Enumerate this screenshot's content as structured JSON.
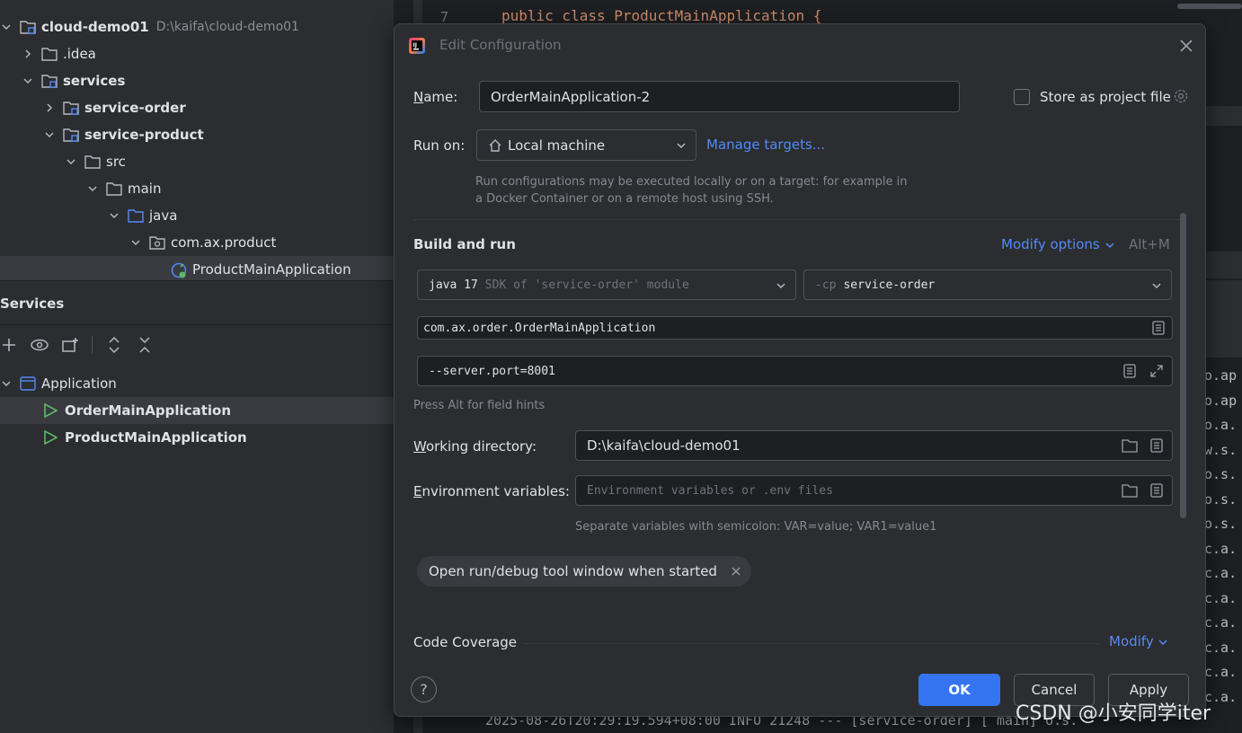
{
  "project_tree": {
    "root": {
      "name": "cloud-demo01",
      "path": "D:\\kaifa\\cloud-demo01"
    },
    "items": [
      {
        "label": ".idea"
      },
      {
        "label": "services"
      },
      {
        "label": "service-order"
      },
      {
        "label": "service-product"
      },
      {
        "label": "src"
      },
      {
        "label": "main"
      },
      {
        "label": "java"
      },
      {
        "label": "com.ax.product"
      },
      {
        "label": "ProductMainApplication"
      }
    ]
  },
  "services_panel": {
    "title": "Services",
    "group": "Application",
    "apps": [
      "OrderMainApplication",
      "ProductMainApplication"
    ]
  },
  "editor": {
    "line_number": "7",
    "code": "public class ProductMainApplication {"
  },
  "console": {
    "right_fragments": [
      "o.ap",
      "o.ap",
      "o.a.",
      "w.s.",
      "o.s.",
      "o.s.",
      "o.s.",
      "c.a.",
      "c.a.",
      "c.a.",
      "c.a.",
      "c.a.",
      "c.a.",
      "c.a."
    ],
    "bottom_line": "2025-08-26T20:29:19.594+08:00  INFO 21248 --- [service-order] [     main] o.s."
  },
  "watermark": "CSDN @小安同学iter",
  "dialog": {
    "title": "Edit Configuration",
    "name_label": "Name:",
    "name_value": "OrderMainApplication-2",
    "store_label": "Store as project file",
    "run_on_label": "Run on:",
    "run_on_value": "Local machine",
    "manage_targets": "Manage targets...",
    "run_on_hint": "Run configurations may be executed locally or on a target: for example in a Docker Container or on a remote host using SSH.",
    "section": "Build and run",
    "modify_options": "Modify options",
    "modify_shortcut": "Alt+M",
    "jdk": {
      "java": "java 17",
      "sdk": "SDK of 'service-order' module"
    },
    "cp": {
      "flag": "-cp",
      "module": "service-order"
    },
    "main_class": "com.ax.order.OrderMainApplication",
    "program_args": "--server.port=8001",
    "field_hint": "Press Alt for field hints",
    "working_dir_label": "Working directory:",
    "working_dir_value": "D:\\kaifa\\cloud-demo01",
    "env_label": "Environment variables:",
    "env_placeholder": "Environment variables or .env files",
    "env_hint": "Separate variables with semicolon: VAR=value; VAR1=value1",
    "chip": "Open run/debug tool window when started",
    "coverage_label": "Code Coverage",
    "coverage_modify": "Modify",
    "ok": "OK",
    "cancel": "Cancel",
    "apply": "Apply",
    "help": "?"
  },
  "colors": {
    "accent": "#548af7",
    "primary_button": "#3574f0",
    "run_icon": "#5fb865",
    "folder_icon": "#8c9bb3",
    "source_folder": "#548af7"
  }
}
